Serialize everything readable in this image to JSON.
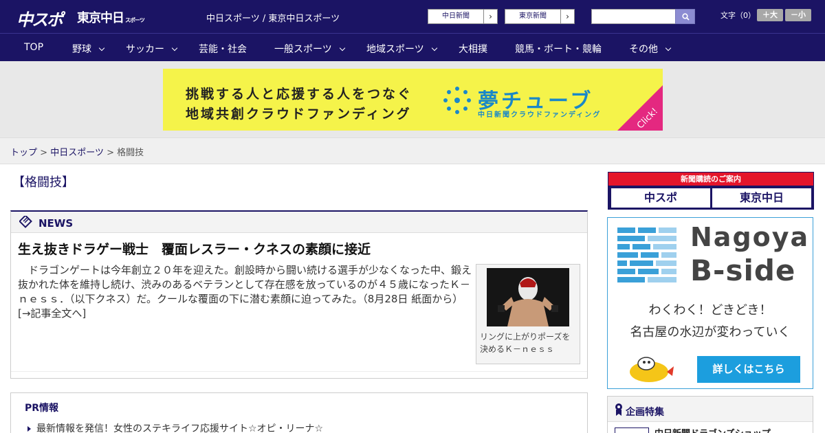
{
  "header": {
    "logo_main": "中スポ",
    "logo_tokyo": "東京中日",
    "logo_tokyo_small": "スポーツ",
    "site_links": "中日スポーツ / 東京中日スポーツ",
    "partner_buttons": [
      "中日新聞",
      "東京新聞"
    ],
    "partner_arrow": "›",
    "search": {
      "placeholder": ""
    },
    "font_size_label": "文字（0）",
    "font_bigger": "＋大",
    "font_smaller": "－小"
  },
  "nav": {
    "items": [
      {
        "label": "TOP",
        "dropdown": false
      },
      {
        "label": "野球",
        "dropdown": true
      },
      {
        "label": "サッカー",
        "dropdown": true
      },
      {
        "label": "芸能・社会",
        "dropdown": false
      },
      {
        "label": "一般スポーツ",
        "dropdown": true
      },
      {
        "label": "地域スポーツ",
        "dropdown": true
      },
      {
        "label": "大相撲",
        "dropdown": false
      },
      {
        "label": "競馬・ボート・競輪",
        "dropdown": false
      },
      {
        "label": "その他",
        "dropdown": true
      }
    ]
  },
  "ad_banner": {
    "line1": "挑戦する人と応援する人をつなぐ",
    "line2": "地域共創クラウドファンディング",
    "brand": "夢チューブ",
    "sub": "中日新聞クラウドファンディング",
    "click": "Click!",
    "colors": {
      "background": "#f5f34a",
      "brand": "#1a88c8",
      "click": "#e42880"
    }
  },
  "breadcrumb": {
    "home": "トップ",
    "sep": ">",
    "section": "中日スポーツ",
    "current": "格闘技"
  },
  "page_title": "【格闘技】",
  "news": {
    "header": "NEWS",
    "title": "生え抜きドラゲー戦士　覆面レスラー・クネスの素顔に接近",
    "body": "　ドラゴンゲートは今年創立２０年を迎えた。創設時から闘い続ける選手が少なくなった中、鍛え抜かれた体を維持し続け、渋みのあるベテランとして存在感を放っているのが４５歳になったＫ－ｎｅｓｓ．（以下クネス）だ。クールな覆面の下に潜む素顔に迫ってみた。（8月28日 紙面から）",
    "more_link": "[→記事全文へ]",
    "photo_caption": "リングに上がりポーズを決めるＫ－ｎｅｓｓ"
  },
  "pr": {
    "header": "PR情報",
    "items": [
      "最新情報を発信！女性のステキライフ応援サイト☆オピ・リーナ☆"
    ]
  },
  "sidebar": {
    "subscribe_header": "新聞購読のご案内",
    "subscribe_buttons": [
      "中スポ",
      "東京中日"
    ],
    "bside": {
      "title1": "Nagoya",
      "title2": "B-side",
      "copy1": "わくわく！どきどき！",
      "copy2": "名古屋の水辺が変わっていく",
      "cta": "詳しくはこちら"
    },
    "kikaku": {
      "header": "企画特集",
      "first_item": "中日新聞ドラゴンズショップ"
    }
  },
  "colors": {
    "brand_navy": "#1b1464",
    "accent_red": "#e4152b",
    "accent_blue": "#1c9ede"
  }
}
